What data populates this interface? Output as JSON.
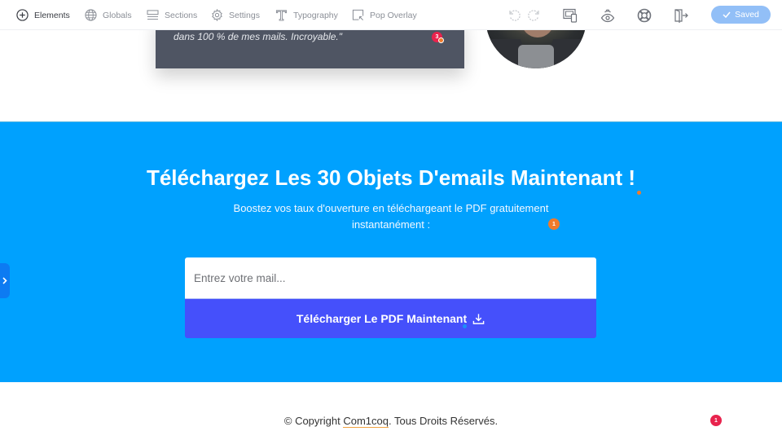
{
  "toolbar": {
    "items": [
      {
        "label": "Elements",
        "icon": "plus-circle-icon",
        "active": true
      },
      {
        "label": "Globals",
        "icon": "globe-icon",
        "active": false
      },
      {
        "label": "Sections",
        "icon": "sections-icon",
        "active": false
      },
      {
        "label": "Settings",
        "icon": "gear-icon",
        "active": false
      },
      {
        "label": "Typography",
        "icon": "typography-icon",
        "active": false
      },
      {
        "label": "Pop Overlay",
        "icon": "pop-overlay-icon",
        "active": false
      }
    ],
    "right_icons": [
      "undo-icon",
      "redo-icon",
      "responsive-preview-icon",
      "preview-eye-icon",
      "help-lifebuoy-icon",
      "exit-icon"
    ],
    "saved_label": "Saved"
  },
  "testimonial": {
    "text": "dans 100 % de mes mails. Incroyable.\"",
    "badge_count": "3"
  },
  "cta": {
    "title": "Téléchargez Les 30 Objets D'emails Maintenant !",
    "subtitle": "Boostez vos taux d'ouverture en téléchargeant le PDF gratuitement instantanément :",
    "subtitle_badge": "1",
    "email_placeholder": "Entrez votre mail...",
    "button_label": "Télécharger Le PDF Maintenant",
    "colors": {
      "background": "#00a1fe",
      "button": "#4550fb"
    }
  },
  "footer": {
    "prefix": "© Copyright ",
    "brand": "Com1coq",
    "suffix": ". Tous Droits Réservés.",
    "badge_count": "1"
  }
}
